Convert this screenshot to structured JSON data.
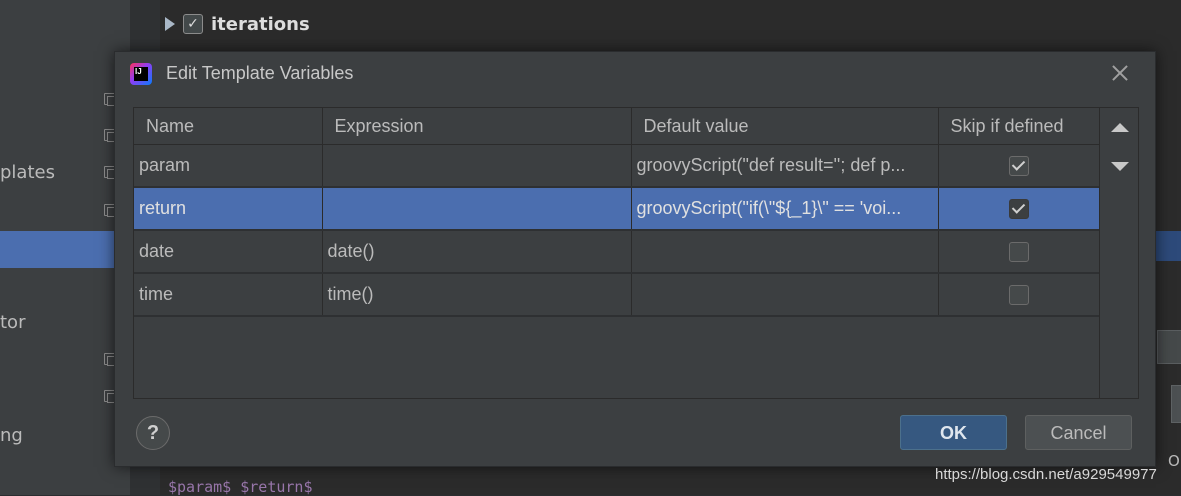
{
  "background": {
    "sidebar_labels": [
      {
        "text": "plates"
      },
      {
        "text": "tor"
      },
      {
        "text": "ng"
      }
    ],
    "tree_item": "iterations",
    "code_line": "$param$ $return$"
  },
  "dialog": {
    "title": "Edit Template Variables",
    "columns": [
      "Name",
      "Expression",
      "Default value",
      "Skip if defined"
    ],
    "rows": [
      {
        "name": "param",
        "expression": "",
        "default_value": "groovyScript(\"def result=''; def p...",
        "skip_if_defined": true,
        "selected": false
      },
      {
        "name": "return",
        "expression": "",
        "default_value": "groovyScript(\"if(\\\"${_1}\\\" == 'voi...",
        "skip_if_defined": true,
        "selected": true
      },
      {
        "name": "date",
        "expression": "date()",
        "default_value": "",
        "skip_if_defined": false,
        "selected": false
      },
      {
        "name": "time",
        "expression": "time()",
        "default_value": "",
        "skip_if_defined": false,
        "selected": false
      }
    ],
    "help_label": "?",
    "ok_label": "OK",
    "cancel_label": "Cancel"
  },
  "watermark": "https://blog.csdn.net/a929549977",
  "colors": {
    "selection": "#4b6eaf",
    "dialog_bg": "#3c3f41",
    "ok_button": "#365880"
  }
}
